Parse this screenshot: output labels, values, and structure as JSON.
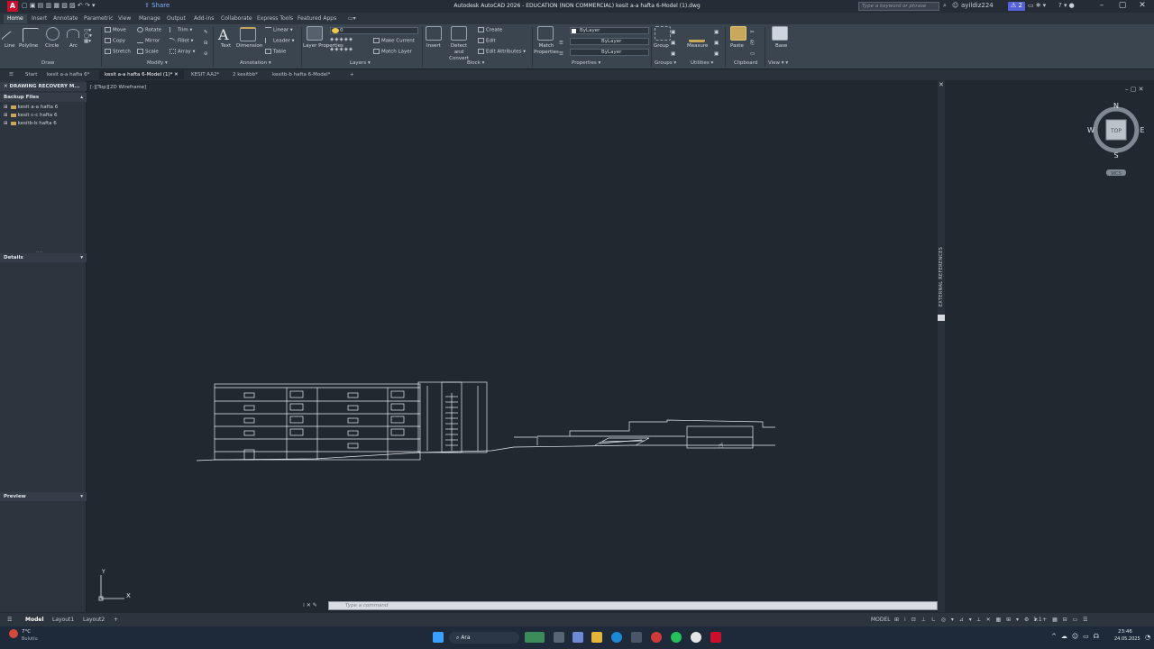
{
  "titlebar": {
    "title": "Autodesk AutoCAD 2026 - EDUCATION (NON COMMERCIAL)   kesit a-a hafta 6-Model (1).dwg",
    "share_label": "Share",
    "search_placeholder": "Type a keyword or phrase",
    "user": "ayildiz224",
    "badge": "2"
  },
  "ribbon_tabs": [
    "Home",
    "Insert",
    "Annotate",
    "Parametric",
    "View",
    "Manage",
    "Output",
    "Add-ins",
    "Collaborate",
    "Express Tools",
    "Featured Apps"
  ],
  "ribbon": {
    "draw": {
      "label": "Draw",
      "tools": [
        "Line",
        "Polyline",
        "Circle",
        "Arc"
      ]
    },
    "modify": {
      "label": "Modify",
      "tools": [
        "Move",
        "Rotate",
        "Trim",
        "Copy",
        "Mirror",
        "Fillet",
        "Stretch",
        "Scale",
        "Array"
      ]
    },
    "annotation": {
      "label": "Annotation",
      "text": "Text",
      "dimension": "Dimension",
      "linear": "Linear",
      "leader": "Leader",
      "table": "Table"
    },
    "layers": {
      "label": "Layers",
      "layer_properties": "Layer Properties",
      "current_layer": "0",
      "make_current": "Make Current",
      "match_layer": "Match Layer"
    },
    "block": {
      "label": "Block",
      "insert": "Insert",
      "detect": "Detect and Convert",
      "create": "Create",
      "edit": "Edit",
      "edit_attributes": "Edit Attributes"
    },
    "properties": {
      "label": "Properties",
      "match": "Match Properties",
      "color": "ByLayer",
      "linetype": "ByLayer",
      "lineweight": "ByLayer"
    },
    "groups": {
      "label": "Groups",
      "group": "Group"
    },
    "utilities": {
      "label": "Utilities",
      "measure": "Measure"
    },
    "clipboard": {
      "label": "Clipboard",
      "paste": "Paste"
    },
    "view": {
      "label": "View",
      "base": "Base"
    }
  },
  "doc_tabs": [
    "Start",
    "kesit a-a hafta 6*",
    "kesit a-a hafta 6-Model (1)*",
    "KESIT AA2*",
    "2 kesitbb*",
    "kesitb-b hafta 6-Model*"
  ],
  "left_panel": {
    "title": "DRAWING RECOVERY M...",
    "backup_files": "Backup Files",
    "files": [
      "kesit a-a hafta 6",
      "kesit c-c hafta 6",
      "kesitb-b hafta 6"
    ],
    "details": "Details",
    "preview": "Preview"
  },
  "viewport_label": "[-][Top][2D Wireframe]",
  "viewcube": {
    "n": "N",
    "s": "S",
    "e": "E",
    "w": "W",
    "top": "TOP",
    "wcs": "WCS"
  },
  "ucs": {
    "x": "X",
    "y": "Y"
  },
  "external_references": "EXTERNAL REFERENCES",
  "command_placeholder": "Type a command",
  "status": {
    "tabs": [
      "Model",
      "Layout1",
      "Layout2"
    ],
    "model_label": "MODEL",
    "scale": "1:1"
  },
  "taskbar": {
    "weather_temp": "7°C",
    "weather_desc": "Bulutlu",
    "search": "Ara",
    "time": "23:46",
    "date": "24.05.2025"
  }
}
